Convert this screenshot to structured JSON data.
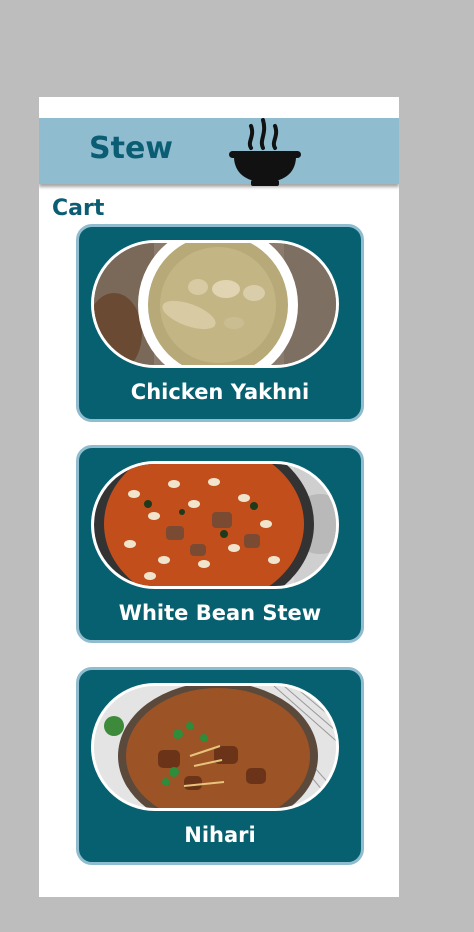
{
  "header": {
    "title": "Stew",
    "icon": "soup-bowl-icon"
  },
  "cart": {
    "label": "Cart"
  },
  "items": [
    {
      "name": "Chicken Yakhni",
      "image": "chicken-yakhni-photo"
    },
    {
      "name": "White Bean Stew",
      "image": "white-bean-stew-photo"
    },
    {
      "name": "Nihari",
      "image": "nihari-photo"
    }
  ],
  "colors": {
    "header_bg": "#8fbccf",
    "brand_dark": "#0b5d73",
    "card_bg": "#06606f",
    "card_border": "#8fbccf",
    "page_bg": "#bdbdbd"
  }
}
